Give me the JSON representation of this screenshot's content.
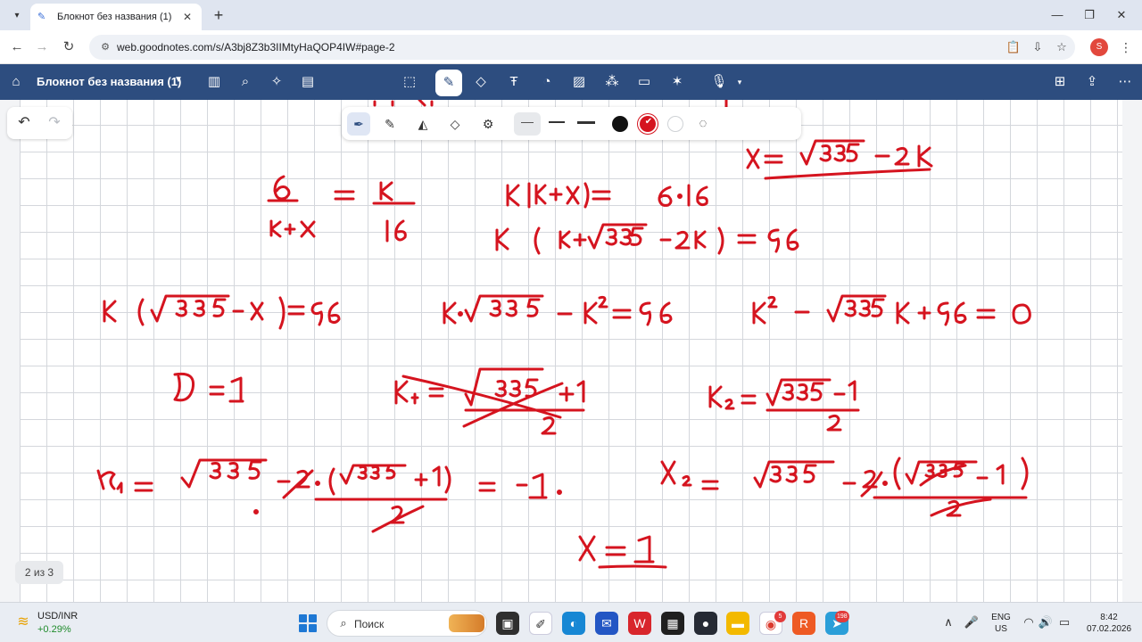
{
  "browser": {
    "tab": {
      "favicon": "goodnotes-favicon",
      "title": "Блокнот без названия (1)"
    },
    "address": "web.goodnotes.com/s/A3bj8Z3b3IIMtyHaQOP4IW#page-2",
    "profile_initial": "S"
  },
  "goodnotes": {
    "notebook_title": "Блокнот без названия (1)",
    "page_indicator": "2 из 3",
    "active_tool": "pen",
    "ink_color": "#d5141f",
    "palette": {
      "colors": [
        "#111111",
        "#d5141f",
        "#ffffff"
      ],
      "selected_color": "#d5141f"
    }
  },
  "taskbar": {
    "stock_name": "USD/INR",
    "stock_delta": "+0.29%",
    "search_placeholder": "Поиск",
    "lang_top": "ENG",
    "lang_bottom": "US",
    "time": "8:42",
    "date": "07.02.2026",
    "badge_chrome": "5",
    "badge_telegram": "198"
  },
  "colors": {
    "toolbar": "#2d4d7f",
    "taskbar": "#e9edf3"
  }
}
